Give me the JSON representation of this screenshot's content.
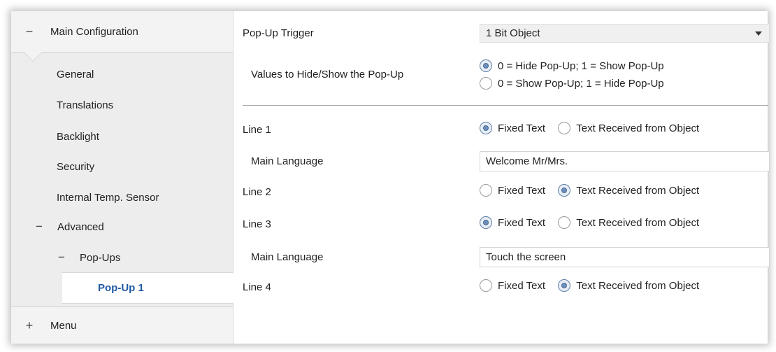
{
  "sidebar": {
    "top_section": {
      "toggle": "−",
      "label": "Main Configuration"
    },
    "items": [
      "General",
      "Translations",
      "Backlight",
      "Security",
      "Internal Temp. Sensor"
    ],
    "advanced": {
      "toggle": "−",
      "label": "Advanced"
    },
    "popups": {
      "toggle": "−",
      "label": "Pop-Ups"
    },
    "selected": {
      "label": "Pop-Up 1"
    },
    "bottom_section": {
      "toggle": "+",
      "label": "Menu"
    }
  },
  "main": {
    "trigger": {
      "label": "Pop-Up Trigger",
      "value": "1 Bit Object"
    },
    "values_hide_show": {
      "label": "Values to Hide/Show the Pop-Up",
      "options": [
        "0 = Hide Pop-Up; 1 = Show Pop-Up",
        "0 = Show Pop-Up; 1 = Hide Pop-Up"
      ],
      "selected": 0
    },
    "option_labels": {
      "fixed": "Fixed Text",
      "received": "Text Received from Object"
    },
    "lines": [
      {
        "label": "Line 1",
        "selected": "fixed",
        "main_language_label": "Main Language",
        "main_language_value": "Welcome Mr/Mrs."
      },
      {
        "label": "Line 2",
        "selected": "received"
      },
      {
        "label": "Line 3",
        "selected": "fixed",
        "main_language_label": "Main Language",
        "main_language_value": "Touch the screen"
      },
      {
        "label": "Line 4",
        "selected": "received"
      }
    ]
  }
}
